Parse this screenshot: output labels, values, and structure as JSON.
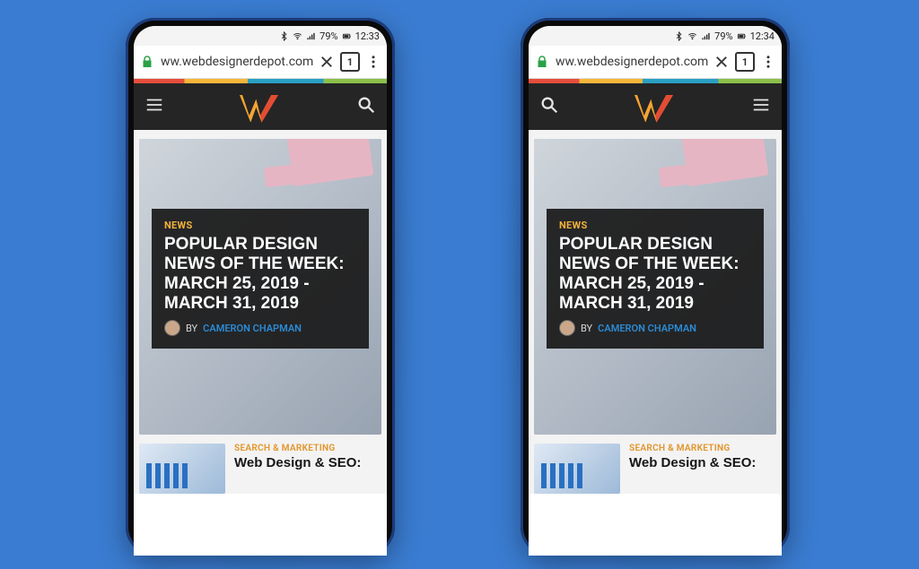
{
  "status": {
    "battery_text": "79%",
    "time": "12:33",
    "time_right": "12:34"
  },
  "browser": {
    "url": "ww.webdesignerdepot.com",
    "tab_count": "1"
  },
  "article": {
    "category": "NEWS",
    "title": "POPULAR DESIGN NEWS OF THE WEEK: MARCH 25, 2019 - MARCH 31, 2019",
    "by_label": "BY",
    "author": "CAMERON CHAPMAN"
  },
  "second_article": {
    "category": "SEARCH & MARKETING",
    "title": "Web Design & SEO:"
  }
}
